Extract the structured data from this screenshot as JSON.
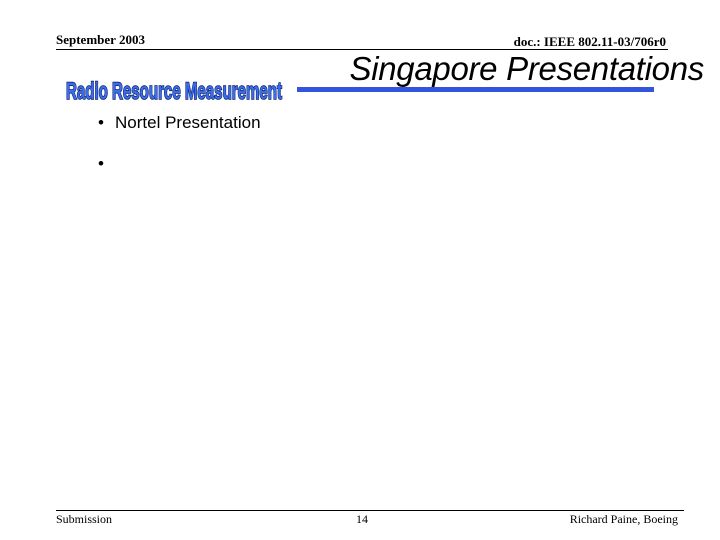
{
  "header": {
    "date": "September 2003",
    "doc_id": "doc.: IEEE 802.11-03/706r0"
  },
  "logo": {
    "text": "Radio Resource Measurement",
    "fill_color": "#3a6ee8",
    "outline_color": "#0a1a66"
  },
  "slide": {
    "title": "Singapore Presentations",
    "title_rule_color": "#3355dd",
    "bullets": [
      {
        "text": "Nortel Presentation"
      },
      {
        "text": ""
      }
    ]
  },
  "footer": {
    "left": "Submission",
    "page": "14",
    "author": "Richard Paine, Boeing"
  }
}
